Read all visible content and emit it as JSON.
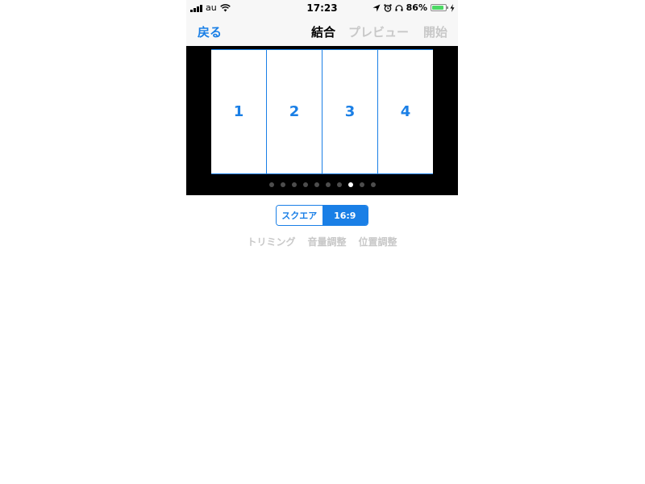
{
  "status_bar": {
    "carrier": "au",
    "time": "17:23",
    "battery_percent": "86%",
    "battery_level": 0.86,
    "icons": [
      "signal-icon",
      "wifi-icon",
      "location-icon",
      "alarm-icon",
      "headphones-icon",
      "battery-icon",
      "charging-icon"
    ]
  },
  "nav": {
    "back": "戻る",
    "combine": "結合",
    "preview": "プレビュー",
    "start": "開始"
  },
  "frames": [
    "1",
    "2",
    "3",
    "4"
  ],
  "page_dots": {
    "count": 10,
    "active_index": 7
  },
  "aspect": {
    "square": "スクエア",
    "wide": "16:9",
    "selected": "16:9"
  },
  "tools": {
    "trim": "トリミング",
    "volume": "音量調整",
    "position": "位置調整"
  },
  "colors": {
    "accent": "#1a7fe6",
    "disabled": "#c8c8c8",
    "battery": "#4cd964"
  }
}
